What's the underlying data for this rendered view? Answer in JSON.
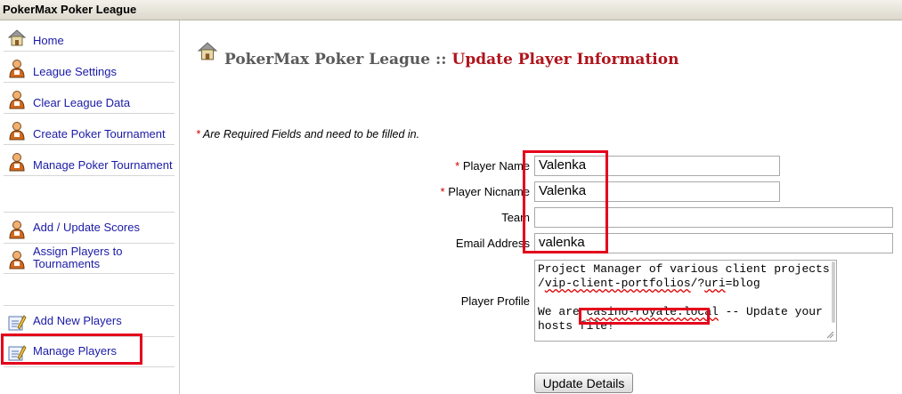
{
  "window": {
    "title": "PokerMax Poker League"
  },
  "sidebar": {
    "items": [
      {
        "label": "Home",
        "icon": "house-icon"
      },
      {
        "label": "League Settings",
        "icon": "user-icon"
      },
      {
        "label": "Clear League Data",
        "icon": "user-icon"
      },
      {
        "label": "Create Poker Tournament",
        "icon": "user-icon"
      },
      {
        "label": "Manage Poker Tournament",
        "icon": "user-icon"
      },
      {
        "label": "Add / Update Scores",
        "icon": "user-icon"
      },
      {
        "label": "Assign Players to Tournaments",
        "icon": "user-icon"
      },
      {
        "label": "Add New Players",
        "icon": "edit-icon"
      },
      {
        "label": "Manage Players",
        "icon": "edit-icon"
      }
    ]
  },
  "header": {
    "site": "PokerMax Poker League",
    "separator": "::",
    "page_title": "Update Player Information"
  },
  "form": {
    "required_star": "*",
    "required_note": "Are Required Fields and need to be filled in.",
    "name": {
      "label": "Player Name",
      "value": "Valenka"
    },
    "nickname": {
      "label": "Player Nicname",
      "value": "Valenka"
    },
    "team": {
      "label": "Team",
      "value": ""
    },
    "email": {
      "label": "Email Address",
      "value": "valenka"
    },
    "profile": {
      "label": "Player Profile",
      "line1": "Project Manager of various client projects on:",
      "line2_pre": "/",
      "line2_sq": "vip-client-portfolios",
      "line2_mid": "/?",
      "line2_sq2": "uri",
      "line2_post": "=blog",
      "line4_pre": "We are ",
      "line4_host": "casino-royale.local",
      "line4_post": " -- Update your",
      "line5": "hosts file!"
    },
    "submit_label": "Update Details"
  },
  "colors": {
    "link": "#1a1aa6",
    "title_accent": "#b0141d",
    "required": "#cc0000",
    "highlight": "#e4001b"
  }
}
